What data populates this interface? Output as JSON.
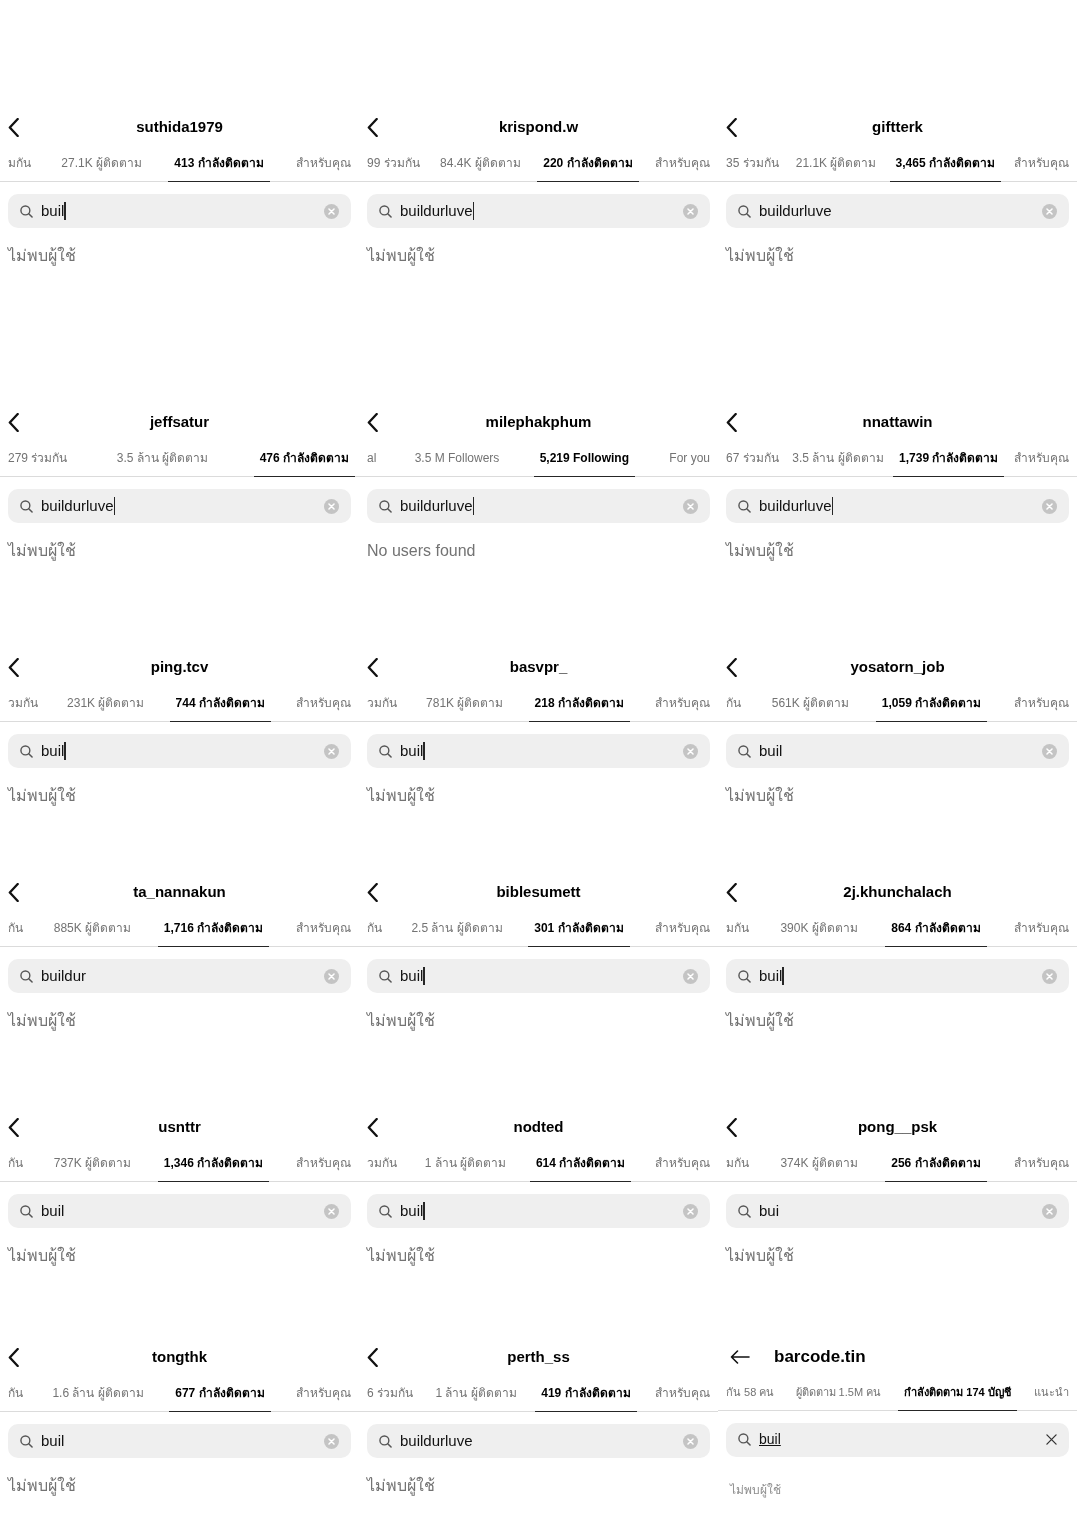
{
  "panels": [
    {
      "kind": "classic",
      "username": "suthida1979",
      "tabs": [
        {
          "label": "มกัน",
          "selected": false
        },
        {
          "label": "27.1K ผู้ติดตาม",
          "selected": false
        },
        {
          "label": "413 กำลังติดตาม",
          "selected": true
        },
        {
          "label": "สำหรับคุณ",
          "selected": false
        }
      ],
      "search": {
        "value": "buil",
        "cursor": true
      },
      "message": "ไม่พบผู้ใช้"
    },
    {
      "kind": "classic",
      "username": "krispond.w",
      "tabs": [
        {
          "label": "99 ร่วมกัน",
          "selected": false
        },
        {
          "label": "84.4K ผู้ติดตาม",
          "selected": false
        },
        {
          "label": "220 กำลังติดตาม",
          "selected": true
        },
        {
          "label": "สำหรับคุณ",
          "selected": false
        }
      ],
      "search": {
        "value": "buildurluve",
        "cursor": true
      },
      "message": "ไม่พบผู้ใช้"
    },
    {
      "kind": "classic",
      "username": "giftterk",
      "tabs": [
        {
          "label": "35 ร่วมกัน",
          "selected": false
        },
        {
          "label": "21.1K ผู้ติดตาม",
          "selected": false
        },
        {
          "label": "3,465 กำลังติดตาม",
          "selected": true
        },
        {
          "label": "สำหรับคุณ",
          "selected": false
        }
      ],
      "search": {
        "value": "buildurluve",
        "cursor": false
      },
      "message": "ไม่พบผู้ใช้"
    },
    {
      "kind": "classic",
      "username": "jeffsatur",
      "tabs": [
        {
          "label": "279 ร่วมกัน",
          "selected": false
        },
        {
          "label": "3.5 ล้าน ผู้ติดตาม",
          "selected": false
        },
        {
          "label": "476 กำลังติดตาม",
          "selected": true
        }
      ],
      "search": {
        "value": "buildurluve",
        "cursor": true
      },
      "message": "ไม่พบผู้ใช้"
    },
    {
      "kind": "classic",
      "username": "milephakphum",
      "tabs": [
        {
          "label": "al",
          "selected": false
        },
        {
          "label": "3.5 M Followers",
          "selected": false
        },
        {
          "label": "5,219 Following",
          "selected": true
        },
        {
          "label": "For you",
          "selected": false
        }
      ],
      "search": {
        "value": "buildurluve",
        "cursor": true
      },
      "message": "No users found"
    },
    {
      "kind": "classic",
      "username": "nnattawin",
      "tabs": [
        {
          "label": "67 ร่วมกัน",
          "selected": false
        },
        {
          "label": "3.5 ล้าน ผู้ติดตาม",
          "selected": false
        },
        {
          "label": "1,739 กำลังติดตาม",
          "selected": true
        },
        {
          "label": "สำหรับคุณ",
          "selected": false
        }
      ],
      "search": {
        "value": "buildurluve",
        "cursor": true
      },
      "message": "ไม่พบผู้ใช้"
    },
    {
      "kind": "classic",
      "username": "ping.tcv",
      "tabs": [
        {
          "label": "วมกัน",
          "selected": false
        },
        {
          "label": "231K ผู้ติดตาม",
          "selected": false
        },
        {
          "label": "744 กำลังติดตาม",
          "selected": true
        },
        {
          "label": "สำหรับคุณ",
          "selected": false
        }
      ],
      "search": {
        "value": "buil",
        "cursor": true
      },
      "message": "ไม่พบผู้ใช้"
    },
    {
      "kind": "classic",
      "username": "basvpr_",
      "tabs": [
        {
          "label": "วมกัน",
          "selected": false
        },
        {
          "label": "781K ผู้ติดตาม",
          "selected": false
        },
        {
          "label": "218 กำลังติดตาม",
          "selected": true
        },
        {
          "label": "สำหรับคุณ",
          "selected": false
        }
      ],
      "search": {
        "value": "buil",
        "cursor": true
      },
      "message": "ไม่พบผู้ใช้"
    },
    {
      "kind": "classic",
      "username": "yosatorn_job",
      "tabs": [
        {
          "label": "กัน",
          "selected": false
        },
        {
          "label": "561K ผู้ติดตาม",
          "selected": false
        },
        {
          "label": "1,059 กำลังติดตาม",
          "selected": true
        },
        {
          "label": "สำหรับคุณ",
          "selected": false
        }
      ],
      "search": {
        "value": "buil",
        "cursor": false
      },
      "message": "ไม่พบผู้ใช้"
    },
    {
      "kind": "classic",
      "username": "ta_nannakun",
      "tabs": [
        {
          "label": "กัน",
          "selected": false
        },
        {
          "label": "885K ผู้ติดตาม",
          "selected": false
        },
        {
          "label": "1,716 กำลังติดตาม",
          "selected": true
        },
        {
          "label": "สำหรับคุณ",
          "selected": false
        }
      ],
      "search": {
        "value": "buildur",
        "cursor": false
      },
      "message": "ไม่พบผู้ใช้"
    },
    {
      "kind": "classic",
      "username": "biblesumett",
      "tabs": [
        {
          "label": "กัน",
          "selected": false
        },
        {
          "label": "2.5 ล้าน ผู้ติดตาม",
          "selected": false
        },
        {
          "label": "301 กำลังติดตาม",
          "selected": true
        },
        {
          "label": "สำหรับคุณ",
          "selected": false
        }
      ],
      "search": {
        "value": "buil",
        "cursor": true
      },
      "message": "ไม่พบผู้ใช้"
    },
    {
      "kind": "classic",
      "username": "2j.khunchalach",
      "tabs": [
        {
          "label": "มกัน",
          "selected": false
        },
        {
          "label": "390K ผู้ติดตาม",
          "selected": false
        },
        {
          "label": "864 กำลังติดตาม",
          "selected": true
        },
        {
          "label": "สำหรับคุณ",
          "selected": false
        }
      ],
      "search": {
        "value": "buil",
        "cursor": true
      },
      "message": "ไม่พบผู้ใช้"
    },
    {
      "kind": "classic",
      "username": "usnttr",
      "tabs": [
        {
          "label": "กัน",
          "selected": false
        },
        {
          "label": "737K ผู้ติดตาม",
          "selected": false
        },
        {
          "label": "1,346 กำลังติดตาม",
          "selected": true
        },
        {
          "label": "สำหรับคุณ",
          "selected": false
        }
      ],
      "search": {
        "value": "buil",
        "cursor": false
      },
      "message": "ไม่พบผู้ใช้"
    },
    {
      "kind": "classic",
      "username": "nodted",
      "tabs": [
        {
          "label": "วมกัน",
          "selected": false
        },
        {
          "label": "1 ล้าน ผู้ติดตาม",
          "selected": false
        },
        {
          "label": "614 กำลังติดตาม",
          "selected": true
        },
        {
          "label": "สำหรับคุณ",
          "selected": false
        }
      ],
      "search": {
        "value": "buil",
        "cursor": true
      },
      "message": "ไม่พบผู้ใช้"
    },
    {
      "kind": "classic",
      "username": "pong__psk",
      "tabs": [
        {
          "label": "มกัน",
          "selected": false
        },
        {
          "label": "374K ผู้ติดตาม",
          "selected": false
        },
        {
          "label": "256 กำลังติดตาม",
          "selected": true
        },
        {
          "label": "สำหรับคุณ",
          "selected": false
        }
      ],
      "search": {
        "value": "bui",
        "cursor": false
      },
      "message": "ไม่พบผู้ใช้"
    },
    {
      "kind": "classic",
      "username": "tongthk",
      "tabs": [
        {
          "label": "กัน",
          "selected": false
        },
        {
          "label": "1.6 ล้าน ผู้ติดตาม",
          "selected": false
        },
        {
          "label": "677 กำลังติดตาม",
          "selected": true
        },
        {
          "label": "สำหรับคุณ",
          "selected": false
        }
      ],
      "search": {
        "value": "buil",
        "cursor": false
      },
      "message": "ไม่พบผู้ใช้"
    },
    {
      "kind": "classic",
      "username": "perth_ss",
      "tabs": [
        {
          "label": "6 ร่วมกัน",
          "selected": false
        },
        {
          "label": "1 ล้าน ผู้ติดตาม",
          "selected": false
        },
        {
          "label": "419 กำลังติดตาม",
          "selected": true
        },
        {
          "label": "สำหรับคุณ",
          "selected": false
        }
      ],
      "search": {
        "value": "buildurluve",
        "cursor": false
      },
      "message": "ไม่พบผู้ใช้"
    },
    {
      "kind": "updated",
      "username": "barcode.tin",
      "tabs": [
        {
          "label": "กัน 58 คน",
          "selected": false
        },
        {
          "label": "ผู้ติดตาม 1.5M คน",
          "selected": false
        },
        {
          "label": "กำลังติดตาม 174 บัญชี",
          "selected": true
        },
        {
          "label": "แนะนำ",
          "selected": false
        }
      ],
      "search": {
        "value": "buil",
        "cursor": false
      },
      "message": "ไม่พบผู้ใช้"
    }
  ]
}
